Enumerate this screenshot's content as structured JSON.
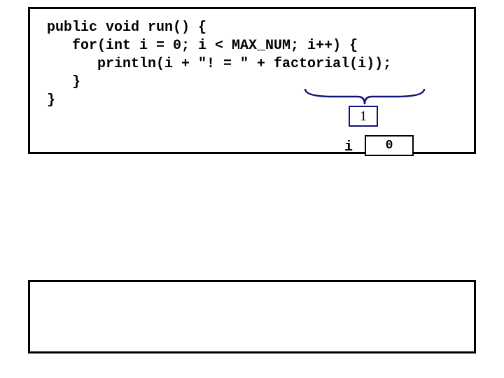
{
  "code": {
    "line1": "public void run() {",
    "line2": "   for(int i = 0; i < MAX_NUM; i++) {",
    "line3": "      println(i + \"! = \" + factorial(i));",
    "line4": "   }",
    "line5": "}"
  },
  "callout": {
    "value": "1"
  },
  "variable": {
    "name": "i",
    "value": "0"
  }
}
